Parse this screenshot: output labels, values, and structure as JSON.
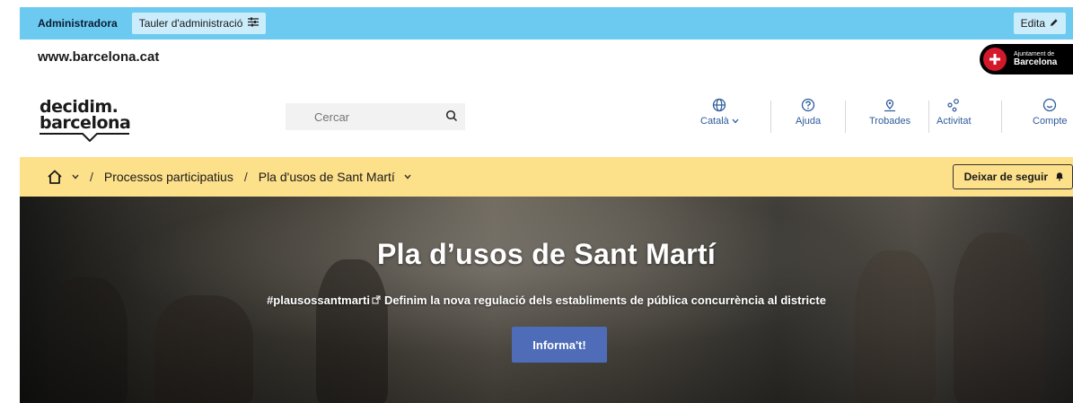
{
  "admin_bar": {
    "user_label": "Administradora",
    "dashboard_label": "Tauler d'administració",
    "edit_label": "Edita"
  },
  "site": {
    "url": "www.barcelona.cat",
    "ajuntament_line1": "Ajuntament de",
    "ajuntament_line2": "Barcelona"
  },
  "header": {
    "logo_line1": "decidim.",
    "logo_line2": "barcelona",
    "search_placeholder": "Cercar",
    "nav": [
      {
        "label": "Català",
        "icon": "globe-icon"
      },
      {
        "label": "Ajuda",
        "icon": "help-icon"
      },
      {
        "label": "Trobades",
        "icon": "map-pin-icon"
      },
      {
        "label": "Activitat",
        "icon": "activity-icon"
      },
      {
        "label": "Compte",
        "icon": "account-icon"
      }
    ]
  },
  "breadcrumb": {
    "items": [
      "Processos participatius",
      "Pla d'usos de Sant Martí"
    ],
    "separator": "/",
    "follow_label": "Deixar de seguir"
  },
  "hero": {
    "title": "Pla d’usos de Sant Martí",
    "hashtag": "#plausossantmarti",
    "description": "Definim la nova regulació dels establiments de pública concurrència al districte",
    "button_label": "Informa't!"
  },
  "colors": {
    "admin_bar": "#6ccaf0",
    "breadcrumb_bar": "#fde08a",
    "nav_text": "#2d5b9a",
    "cta": "#4e6cb8",
    "ajuntament_red": "#d4182c"
  }
}
